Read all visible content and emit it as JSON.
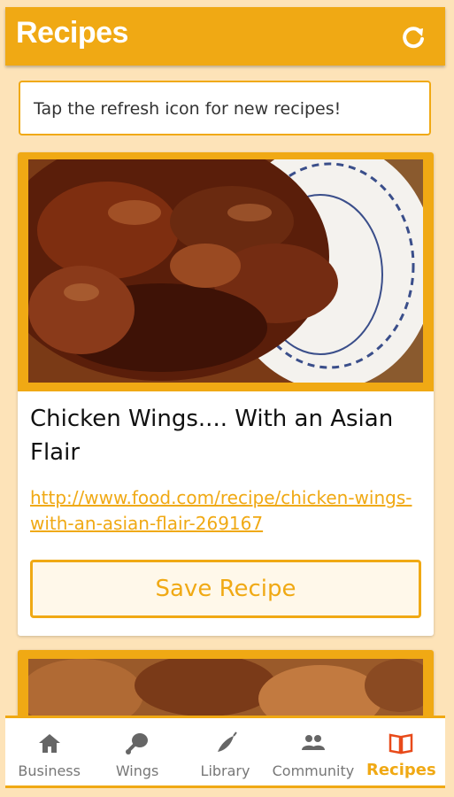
{
  "appbar": {
    "title": "Recipes",
    "refresh_icon": "refresh-icon"
  },
  "tip": {
    "text": "Tap the refresh icon for new recipes!"
  },
  "recipes": [
    {
      "name": "Chicken Wings.... With an Asian Flair",
      "url": "http://www.food.com/recipe/chicken-wings-with-an-asian-flair-269167",
      "save_label": "Save Recipe"
    }
  ],
  "bottom_nav": {
    "items": [
      {
        "label": "Business",
        "icon": "home-icon",
        "active": false
      },
      {
        "label": "Wings",
        "icon": "drumstick-icon",
        "active": false
      },
      {
        "label": "Library",
        "icon": "pepper-icon",
        "active": false
      },
      {
        "label": "Community",
        "icon": "people-icon",
        "active": false
      },
      {
        "label": "Recipes",
        "icon": "book-icon",
        "active": true
      }
    ]
  },
  "colors": {
    "accent": "#f0a914",
    "background": "#fde3b8",
    "inactive": "#777777"
  }
}
